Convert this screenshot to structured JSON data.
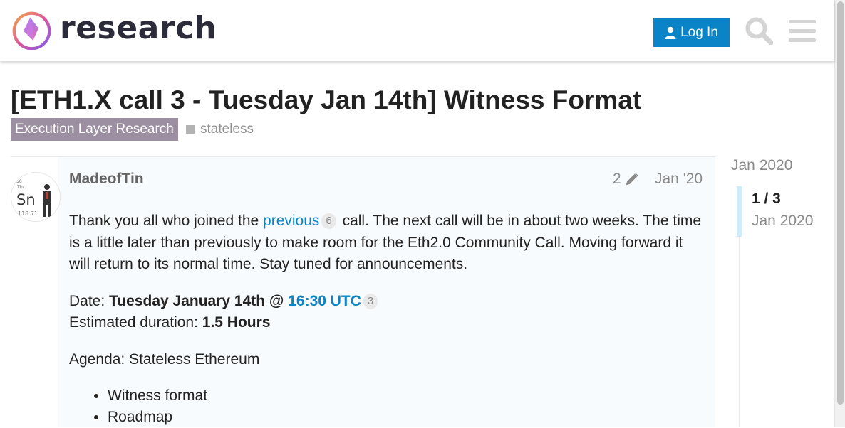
{
  "header": {
    "site_name": "research",
    "login_label": "Log In",
    "colors": {
      "login_bg": "#0a84c7",
      "icon": "#d4d4d4"
    }
  },
  "topic": {
    "title": "[ETH1.X call 3 - Tuesday Jan 14th] Witness Format",
    "category": "Execution Layer Research",
    "tag": "stateless",
    "colors": {
      "category_bg": "#9c8fa1"
    }
  },
  "post": {
    "username": "MadeofTin",
    "edit_count": "2",
    "date": "Jan '20",
    "avatar_text": {
      "top": "Tin",
      "main": "Sn",
      "bottom": "118.71",
      "corner": "50"
    },
    "para1": {
      "before": "Thank you all who joined the ",
      "link": "previous",
      "link_clicks": "6",
      "after": " call. The next call will be in about two weeks. The time is a little later than previously to make room for the Eth2.0 Community Call. Moving forward it will return to its normal time. Stay tuned for announcements."
    },
    "para2": {
      "date_label": "Date: ",
      "date_value": "Tuesday January 14th @ ",
      "time_link": "16:30 UTC",
      "time_clicks": "3",
      "duration_label": "Estimated duration: ",
      "duration_value": "1.5 Hours"
    },
    "agenda": "Agenda: Stateless Ethereum",
    "agenda_items": [
      "Witness format",
      "Roadmap"
    ]
  },
  "timeline": {
    "start": "Jan 2020",
    "position": "1 / 3",
    "current_date": "Jan 2020"
  }
}
